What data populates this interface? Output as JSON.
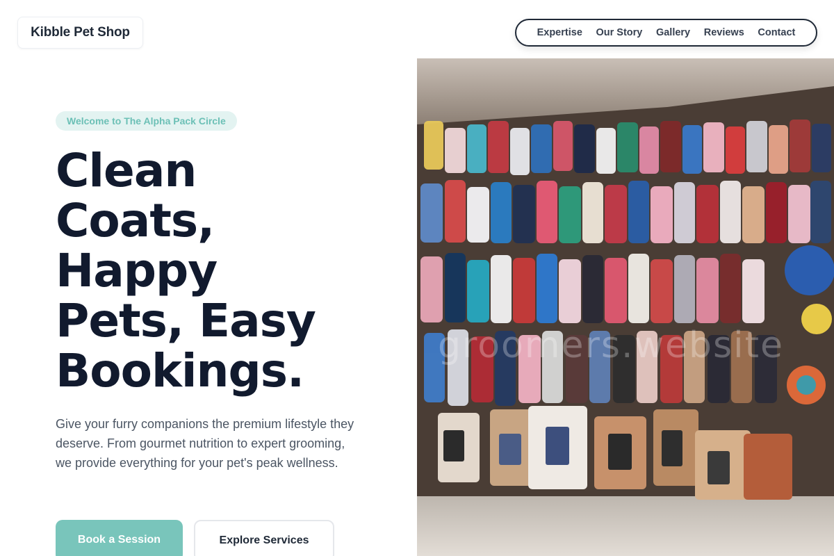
{
  "brand": {
    "name": "Kibble Pet Shop"
  },
  "nav": {
    "items": [
      "Expertise",
      "Our Story",
      "Gallery",
      "Reviews",
      "Contact"
    ]
  },
  "hero": {
    "badge": "Welcome to The Alpha Pack Circle",
    "headline_lines": [
      "Clean",
      "Coats,",
      "Happy",
      "Pets, Easy",
      "Bookings."
    ],
    "lead": "Give your furry companions the premium lifestyle they deserve. From gourmet nutrition to expert grooming, we provide everything for your pet's peak wellness.",
    "primary_button": "Book a Session",
    "secondary_button": "Explore Services",
    "image_watermark": "groomers.website"
  },
  "colors": {
    "accent": "#79c5bb",
    "badge_bg": "#e3f3f1",
    "badge_text": "#6cc0b6",
    "heading": "#111a2e",
    "body_text": "#4b5563",
    "nav_border": "#1f2937"
  }
}
